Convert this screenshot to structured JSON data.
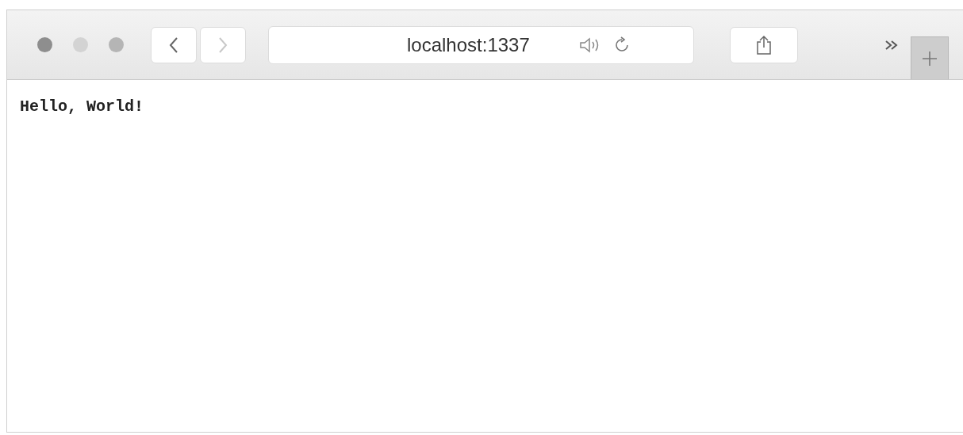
{
  "toolbar": {
    "back": {
      "disabled": false
    },
    "forward": {
      "disabled": true
    },
    "address": {
      "value": "localhost:1337"
    }
  },
  "page": {
    "text": "Hello, World!"
  }
}
